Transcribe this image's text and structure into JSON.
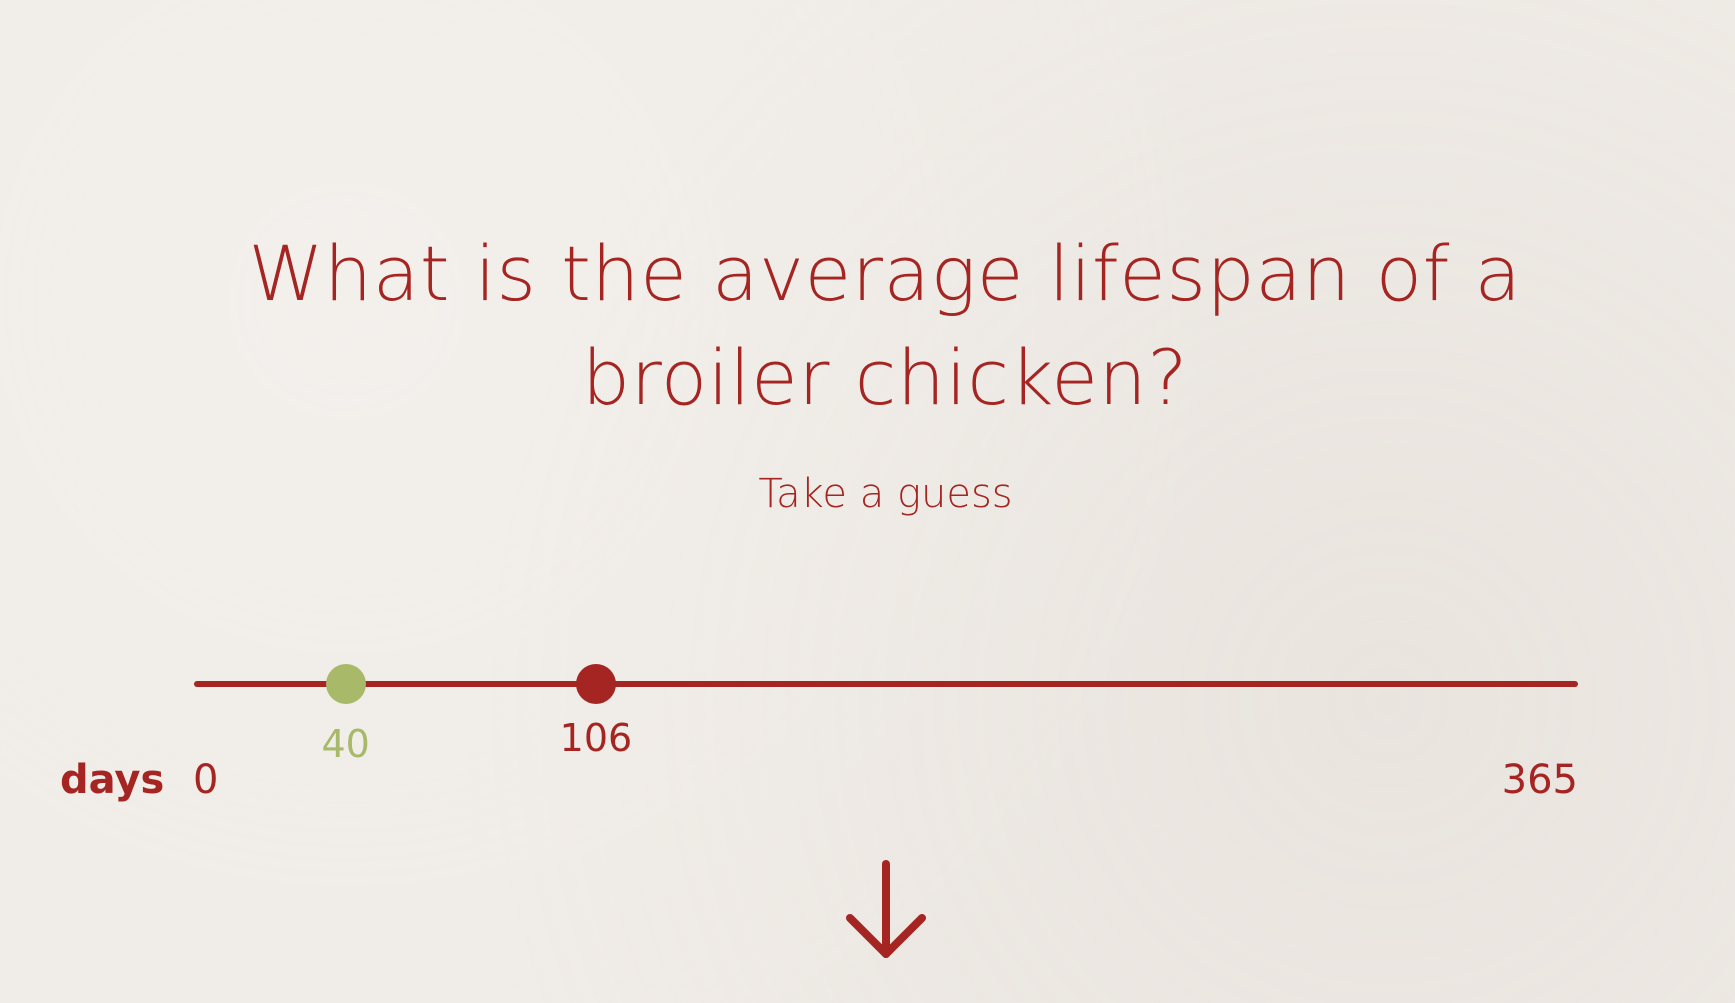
{
  "question": {
    "text": "What is the average lifespan of a broiler chicken?",
    "subtitle": "Take a guess"
  },
  "slider": {
    "unit": "days",
    "min": 0,
    "max": 365,
    "min_label": "0",
    "max_label": "365",
    "answer": {
      "value": 40,
      "label": "40",
      "color": "#a8b96a"
    },
    "guess": {
      "value": 106,
      "label": "106",
      "color": "#a52522"
    }
  },
  "navigation": {
    "scroll_icon": "arrow-down-icon"
  },
  "colors": {
    "accent": "#a52522",
    "answer": "#a8b96a",
    "background": "#efebe6"
  }
}
